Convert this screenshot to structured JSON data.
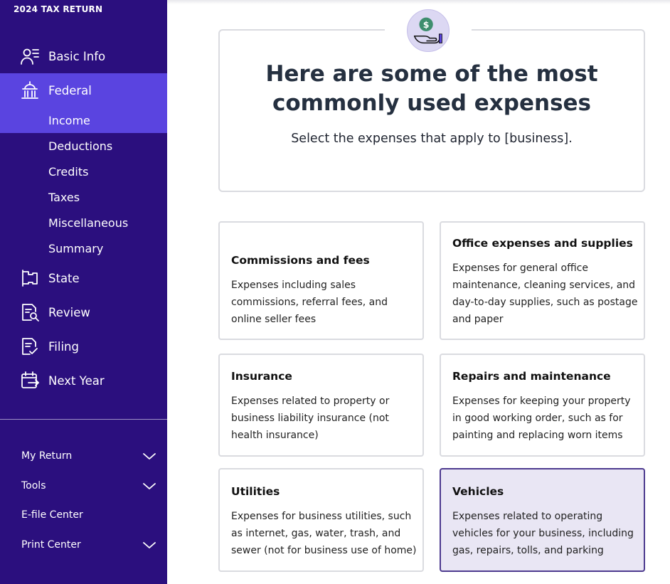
{
  "app_title": "2024 TAX RETURN",
  "nav": {
    "basic_info": "Basic Info",
    "federal": "Federal",
    "state": "State",
    "review": "Review",
    "filing": "Filing",
    "next_year": "Next Year"
  },
  "federal_sub": {
    "income": "Income",
    "deductions": "Deductions",
    "credits": "Credits",
    "taxes": "Taxes",
    "miscellaneous": "Miscellaneous",
    "summary": "Summary"
  },
  "utility": {
    "my_return": "My Return",
    "tools": "Tools",
    "efile_center": "E-file Center",
    "print_center": "Print Center"
  },
  "hero": {
    "title_line1": "Here are some of the most",
    "title_line2": "commonly used expenses",
    "subtitle": "Select the expenses that apply to [business]."
  },
  "cards": [
    {
      "title": "Commissions and fees",
      "desc": "Expenses including sales commissions, referral fees, and online seller fees",
      "selected": false
    },
    {
      "title": "Office expenses and supplies",
      "desc": "Expenses for general office maintenance, cleaning services, and day-to-day supplies, such as postage and paper",
      "selected": false
    },
    {
      "title": "Insurance",
      "desc": "Expenses related to property or business liability insurance (not health insurance)",
      "selected": false
    },
    {
      "title": "Repairs and maintenance",
      "desc": "Expenses for keeping your property in good working order, such as for painting and replacing worn items",
      "selected": false
    },
    {
      "title": "Utilities",
      "desc": "Expenses for business utilities, such as internet, gas, water, trash, and sewer (not for business use of home)",
      "selected": false
    },
    {
      "title": "Vehicles",
      "desc": "Expenses related to operating vehicles for your business, including gas, repairs, tolls, and parking",
      "selected": true
    }
  ],
  "colors": {
    "sidebar_bg": "#2b0f7e",
    "active_bg": "#5a44e0",
    "selected_card_bg": "#e9e6f4",
    "icon_green": "#3e8e6e"
  }
}
